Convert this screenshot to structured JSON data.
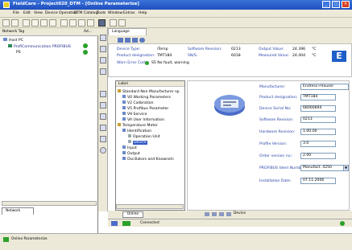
{
  "window": {
    "title": "FieldCare - Project020_DTM - [Online Parameterize]"
  },
  "menu": [
    "File",
    "Edit",
    "View",
    "Device Operation",
    "DTM Catalog",
    "Tools",
    "Window",
    "Extras",
    "Help"
  ],
  "network_pane": {
    "title": "Network Tag",
    "column": "Ad...",
    "items": [
      "Host PC",
      "ProfiCommunication PROFIBUS",
      "PS"
    ],
    "bottom_tab": "Network"
  },
  "language_label": "Language",
  "device_header": {
    "device_type_label": "Device Type:",
    "device_type_value": "iTemp",
    "product_designation_label": "Product designation:",
    "product_designation_value": "TMT184",
    "status_label": "Warn Error Code:",
    "status_value": "S5 No fault, warning",
    "software_revision_label": "Software Revision:",
    "software_revision_value": "0213",
    "serial_label": "SN/S:",
    "serial_value": "6018",
    "output_label": "Output Value:",
    "output_value": "24.396",
    "output_unit": "°C",
    "measured_label": "Measured Value:",
    "measured_value": "24.404",
    "measured_unit": "°C"
  },
  "tree": {
    "header": "Label",
    "items": [
      "Standard Non Manufacturer sp",
      "V0 Working Parameters",
      "V2 Calibration",
      "V5 Profibus Parameter",
      "V9 Service",
      "VA User Information",
      "Temperature Meter",
      "Identification",
      "Operation Unit",
      "Device",
      "Input",
      "Output",
      "Oscillators and Knownshi"
    ]
  },
  "fields": [
    {
      "label": "Manufacturer:",
      "value": "Endress+Hauser"
    },
    {
      "label": "Product designation:",
      "value": "TMT184"
    },
    {
      "label": "Device Serial No:",
      "value": "68000694"
    },
    {
      "label": "Software Revision:",
      "value": "0213"
    },
    {
      "label": "Hardware Revision:",
      "value": "1.00.00"
    },
    {
      "label": "Profile Version:",
      "value": "3.0"
    },
    {
      "label": "Order version no.:",
      "value": "2.00"
    },
    {
      "label": "PROFIBUS Ident Number:",
      "value": "Manufact. 4250",
      "dropdown": true
    },
    {
      "label": "Installation Date:",
      "value": "07.11.2006"
    }
  ],
  "bottom": {
    "online_tab": "Online",
    "device_tab": "Device",
    "connection_status": "Connected",
    "status_bar_item": "Online Parameterize"
  },
  "colors": {
    "titlebar": "#1f4fbf",
    "label_blue": "#2a46a8",
    "selection": "#2f58c0",
    "chrome": "#ece9d8",
    "eh_logo": "#1f5fc8"
  }
}
